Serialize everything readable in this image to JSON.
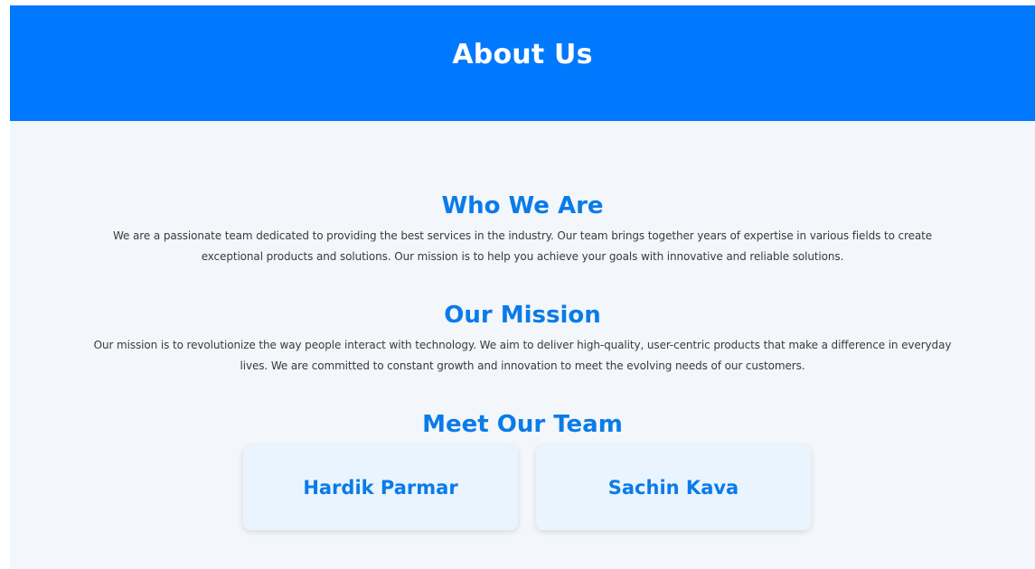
{
  "header": {
    "title": "About Us"
  },
  "who_we_are": {
    "heading": "Who We Are",
    "text": "We are a passionate team dedicated to providing the best services in the industry. Our team brings together years of expertise in various fields to create exceptional products and solutions. Our mission is to help you achieve your goals with innovative and reliable solutions."
  },
  "our_mission": {
    "heading": "Our Mission",
    "text": "Our mission is to revolutionize the way people interact with technology. We aim to deliver high-quality, user-centric products that make a difference in everyday lives. We are committed to constant growth and innovation to meet the evolving needs of our customers."
  },
  "team": {
    "heading": "Meet Our Team",
    "members": [
      {
        "name": "Hardik Parmar"
      },
      {
        "name": "Sachin Kava"
      }
    ]
  },
  "colors": {
    "header_bg": "#0179fe",
    "accent": "#0a7be8",
    "page_bg": "#f3f6fa",
    "card_bg": "#e9f4fe"
  }
}
